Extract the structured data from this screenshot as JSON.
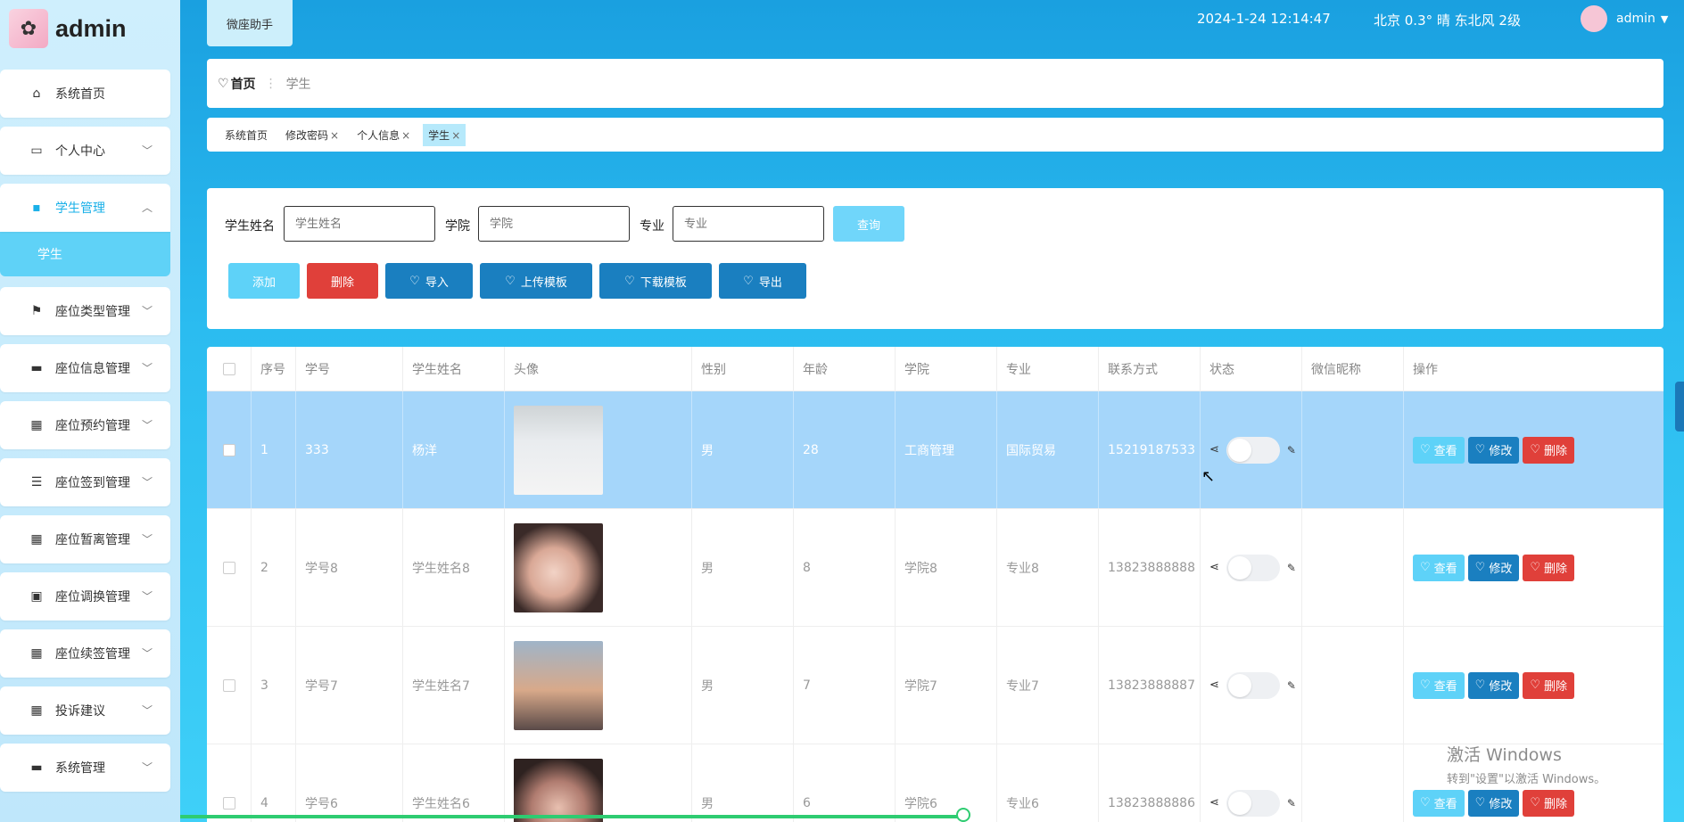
{
  "brand": {
    "title": "admin"
  },
  "sidebar": {
    "items": [
      {
        "label": "系统首页",
        "icon": "home-icon"
      },
      {
        "label": "个人中心",
        "icon": "card-icon"
      },
      {
        "label": "学生管理",
        "icon": "chat-icon"
      },
      {
        "label": "座位类型管理",
        "icon": "flag-icon"
      },
      {
        "label": "座位信息管理",
        "icon": "ticket-icon"
      },
      {
        "label": "座位预约管理",
        "icon": "grid-icon"
      },
      {
        "label": "座位签到管理",
        "icon": "sliders-icon"
      },
      {
        "label": "座位暂离管理",
        "icon": "apps-icon"
      },
      {
        "label": "座位调换管理",
        "icon": "clipboard-icon"
      },
      {
        "label": "座位续签管理",
        "icon": "grid-icon"
      },
      {
        "label": "投诉建议",
        "icon": "grid-icon"
      },
      {
        "label": "系统管理",
        "icon": "monitor-icon"
      }
    ],
    "submenu_label": "学生"
  },
  "header": {
    "assistant_label": "微座助手",
    "datetime": "2024-1-24 12:14:47",
    "weather": "北京 0.3° 晴 东北风 2级",
    "username": "admin"
  },
  "breadcrumb": {
    "home": "首页",
    "current": "学生"
  },
  "tags": [
    {
      "label": "系统首页",
      "closable": false
    },
    {
      "label": "修改密码",
      "closable": true
    },
    {
      "label": "个人信息",
      "closable": true
    },
    {
      "label": "学生",
      "closable": true,
      "active": true
    }
  ],
  "search": {
    "name_label": "学生姓名",
    "name_placeholder": "学生姓名",
    "college_label": "学院",
    "college_placeholder": "学院",
    "major_label": "专业",
    "major_placeholder": "专业",
    "query_label": "查询"
  },
  "actions": {
    "add": "添加",
    "delete": "删除",
    "import": "导入",
    "upload_template": "上传模板",
    "download_template": "下载模板",
    "export": "导出"
  },
  "table": {
    "headers": [
      "序号",
      "学号",
      "学生姓名",
      "头像",
      "性别",
      "年龄",
      "学院",
      "专业",
      "联系方式",
      "状态",
      "微信昵称",
      "操作"
    ],
    "rows": [
      {
        "idx": "1",
        "no": "333",
        "name": "杨洋",
        "sex": "男",
        "age": "28",
        "college": "工商管理",
        "major": "国际贸易",
        "phone": "15219187533",
        "selected": true
      },
      {
        "idx": "2",
        "no": "学号8",
        "name": "学生姓名8",
        "sex": "男",
        "age": "8",
        "college": "学院8",
        "major": "专业8",
        "phone": "13823888888",
        "selected": false
      },
      {
        "idx": "3",
        "no": "学号7",
        "name": "学生姓名7",
        "sex": "男",
        "age": "7",
        "college": "学院7",
        "major": "专业7",
        "phone": "13823888887",
        "selected": false
      },
      {
        "idx": "4",
        "no": "学号6",
        "name": "学生姓名6",
        "sex": "男",
        "age": "6",
        "college": "学院6",
        "major": "专业6",
        "phone": "13823888886",
        "selected": false
      }
    ],
    "op_labels": {
      "view": "查看",
      "edit": "修改",
      "delete": "删除"
    }
  },
  "watermark": {
    "line1": "激活 Windows",
    "line2": "转到\"设置\"以激活 Windows。"
  },
  "colors": {
    "accent": "#1ab0e8",
    "view": "#5ed2f8",
    "edit": "#1a7fc0",
    "delete": "#e0403a",
    "selected_row": "#a5d6fa"
  }
}
